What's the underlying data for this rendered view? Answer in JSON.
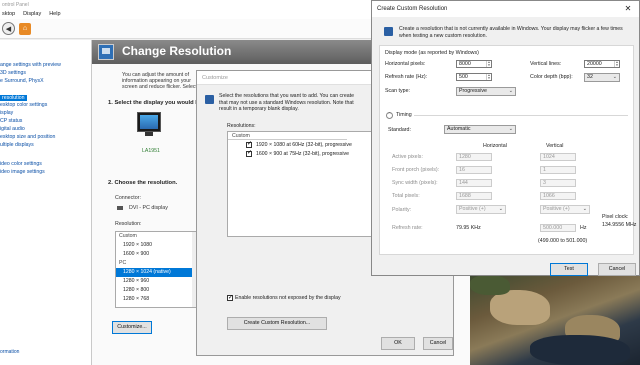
{
  "ncp": {
    "title": "ontrol Panel",
    "menu": [
      "sktop",
      "Display",
      "Help"
    ],
    "left_items": [
      {
        "label": "ange settings with preview",
        "selected": false
      },
      {
        "label": "3D settings",
        "selected": false
      },
      {
        "label": "e Surround, PhysX",
        "selected": false
      },
      {
        "label": "resolution",
        "selected": true
      },
      {
        "label": "esktop color settings",
        "selected": false
      },
      {
        "label": "isplay",
        "selected": false
      },
      {
        "label": "CP status",
        "selected": false
      },
      {
        "label": "igital audio",
        "selected": false
      },
      {
        "label": "esktop size and position",
        "selected": false
      },
      {
        "label": "ultiple displays",
        "selected": false
      },
      {
        "label": "ideo color settings",
        "selected": false
      },
      {
        "label": "ideo image settings",
        "selected": false
      }
    ],
    "bottom_link": "ormation",
    "page_title": "Change Resolution",
    "page_desc": "You can adjust the amount of information appearing on your screen and reduce flicker. Select your country-specific signal for your HDTV.",
    "step1": "1. Select the display you would like to change.",
    "monitor_label": "LA1951",
    "step2": "2. Choose the resolution.",
    "connector_label": "Connector:",
    "connector_value": "DVI - PC display",
    "resolution_label": "Resolution:",
    "resolution_list": [
      {
        "label": "Custom",
        "group": true,
        "selected": false
      },
      {
        "label": "1920 × 1080",
        "group": false,
        "selected": false
      },
      {
        "label": "1600 × 900",
        "group": false,
        "selected": false
      },
      {
        "label": "PC",
        "group": true,
        "selected": false
      },
      {
        "label": "1280 × 1024 (native)",
        "group": false,
        "selected": true
      },
      {
        "label": "1280 × 960",
        "group": false,
        "selected": false
      },
      {
        "label": "1280 × 800",
        "group": false,
        "selected": false
      },
      {
        "label": "1280 × 768",
        "group": false,
        "selected": false
      }
    ],
    "customize_button": "Customize..."
  },
  "customize": {
    "title": "Customize",
    "desc_line1": "Select the resolutions that you want to add. You can create",
    "desc_line2": "that may not use a standard Windows resolution. Note that",
    "desc_line3": "result in a temporary blank display.",
    "resolutions_label": "Resolutions:",
    "list_header": "Custom",
    "list_items": [
      {
        "label": "1920 × 1080 at 60Hz (32-bit), progressive",
        "checked": true
      },
      {
        "label": "1600 × 900 at 75Hz (32-bit), progressive",
        "checked": true
      }
    ],
    "enable_label": "Enable resolutions not exposed by the display",
    "enable_checked": true,
    "create_button": "Create Custom Resolution...",
    "ok_button": "OK",
    "cancel_button": "Cancel"
  },
  "ccr": {
    "title": "Create Custom Resolution",
    "desc": "Create a resolution that is not currently available in Windows. Your display may flicker a few times when testing a new custom resolution.",
    "display_mode_label": "Display mode (as reported by Windows)",
    "horizontal_pixels_label": "Horizontal pixels:",
    "horizontal_pixels_value": "8000",
    "vertical_lines_label": "Vertical lines:",
    "vertical_lines_value": "20000",
    "refresh_rate_label": "Refresh rate (Hz):",
    "refresh_rate_value": "500",
    "color_depth_label": "Color depth (bpp):",
    "color_depth_value": "32",
    "scan_type_label": "Scan type:",
    "scan_type_value": "Progressive",
    "timing_label": "Timing",
    "standard_label": "Standard:",
    "standard_value": "Automatic",
    "horizontal_header": "Horizontal",
    "vertical_header": "Vertical",
    "active_pixels_label": "Active pixels:",
    "active_h": "1280",
    "active_v": "1024",
    "front_porch_label": "Front porch (pixels):",
    "front_h": "16",
    "front_v": "1",
    "sync_width_label": "Sync width (pixels):",
    "sync_h": "144",
    "sync_v": "3",
    "total_pixels_label": "Total pixels:",
    "total_h": "1688",
    "total_v": "1066",
    "polarity_label": "Polarity:",
    "polarity_h": "Positive (+)",
    "polarity_v": "Positive (+)",
    "pixel_clock_label": "Pixel clock:",
    "pixel_clock_value": "134.9556 MHz",
    "refresh_label": "Refresh rate:",
    "refresh_h": "79.95 KHz",
    "refresh_v": "500.000",
    "refresh_v_unit": "Hz",
    "refresh_range": "(499.000 to 501.000)",
    "test_button": "Test",
    "cancel_button": "Cancel",
    "close_glyph": "✕"
  },
  "colors": {
    "accent": "#0078d7",
    "link": "#0a4fa6",
    "monitor_label": "#2e7d32"
  }
}
